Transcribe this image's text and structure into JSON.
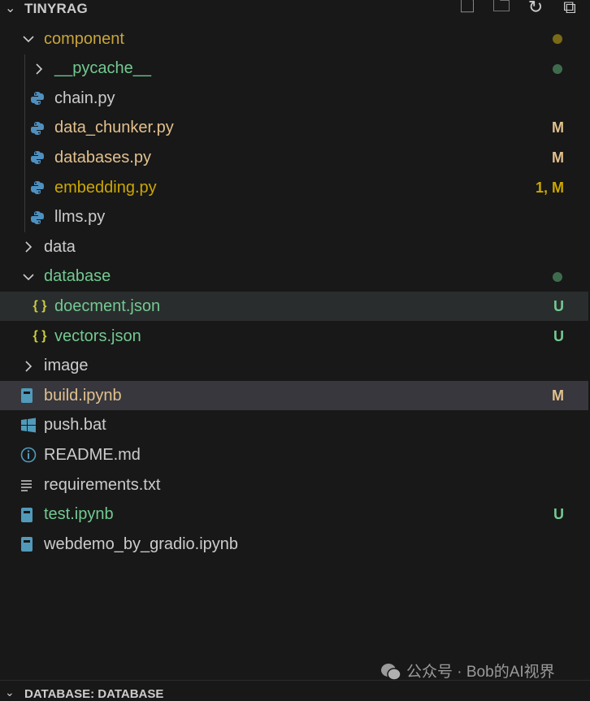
{
  "explorer": {
    "title": "TINYRAG",
    "actions": [
      {
        "name": "new-file",
        "glyph": "🗋"
      },
      {
        "name": "new-folder",
        "glyph": "🗀"
      },
      {
        "name": "refresh",
        "glyph": "↻"
      },
      {
        "name": "collapse-all",
        "glyph": "⧉"
      }
    ],
    "items": [
      {
        "label": "component",
        "type": "folder",
        "open": true,
        "level": 1,
        "color": "#c9a43a",
        "dot": "#7a6a16"
      },
      {
        "label": "__pycache__",
        "type": "folder",
        "open": false,
        "level": 2,
        "color": "#73c991",
        "dot": "#3f6b4d"
      },
      {
        "label": "chain.py",
        "type": "python",
        "level": 2,
        "color": "#cccccc"
      },
      {
        "label": "data_chunker.py",
        "type": "python",
        "level": 2,
        "color": "#e2c08d",
        "badge": "M"
      },
      {
        "label": "databases.py",
        "type": "python",
        "level": 2,
        "color": "#e2c08d",
        "badge": "M"
      },
      {
        "label": "embedding.py",
        "type": "python",
        "level": 2,
        "color": "#cca700",
        "badge": "1, M"
      },
      {
        "label": "llms.py",
        "type": "python",
        "level": 2,
        "color": "#cccccc"
      },
      {
        "label": "data",
        "type": "folder",
        "open": false,
        "level": 1,
        "color": "#cccccc"
      },
      {
        "label": "database",
        "type": "folder",
        "open": true,
        "level": 1,
        "color": "#73c991",
        "dot": "#3f6b4d"
      },
      {
        "label": "doecment.json",
        "type": "json",
        "level": 2,
        "color": "#73c991",
        "badge": "U",
        "state": "hover"
      },
      {
        "label": "vectors.json",
        "type": "json",
        "level": 2,
        "color": "#73c991",
        "badge": "U"
      },
      {
        "label": "image",
        "type": "folder",
        "open": false,
        "level": 1,
        "color": "#cccccc"
      },
      {
        "label": "build.ipynb",
        "type": "notebook",
        "level": 1,
        "color": "#e2c08d",
        "badge": "M",
        "state": "selected"
      },
      {
        "label": "push.bat",
        "type": "windows",
        "level": 1,
        "color": "#cccccc"
      },
      {
        "label": "README.md",
        "type": "info",
        "level": 1,
        "color": "#cccccc"
      },
      {
        "label": "requirements.txt",
        "type": "text",
        "level": 1,
        "color": "#cccccc"
      },
      {
        "label": "test.ipynb",
        "type": "notebook",
        "level": 1,
        "color": "#73c991",
        "badge": "U"
      },
      {
        "label": "webdemo_by_gradio.ipynb",
        "type": "notebook",
        "level": 1,
        "color": "#cccccc"
      }
    ]
  },
  "bottom_section": {
    "title": "DATABASE: DATABASE"
  },
  "watermark": "公众号 · Bob的AI视界"
}
